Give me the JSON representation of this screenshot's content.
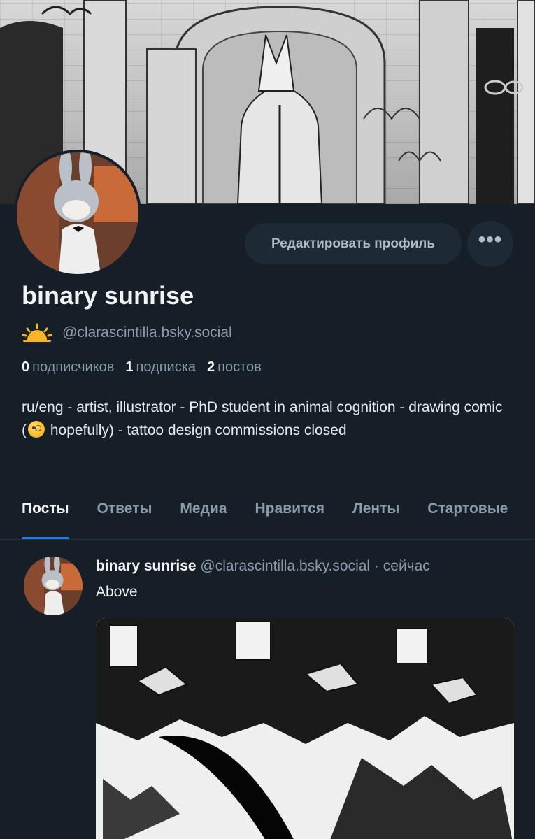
{
  "profile": {
    "display_name": "binary sunrise",
    "handle": "@clarascintilla.bsky.social",
    "edit_button_label": "Редактировать профиль",
    "more_button_label": "•••",
    "stats": {
      "followers_count": "0",
      "followers_label": "подписчиков",
      "following_count": "1",
      "following_label": "подписка",
      "posts_count": "2",
      "posts_label": "постов"
    },
    "bio": {
      "part1": "ru/eng - artist, illustrator - PhD student in animal cognition - drawing comic (",
      "part2": " hopefully) - tattoo design commissions closed"
    }
  },
  "tabs": [
    {
      "label": "Посты",
      "active": true
    },
    {
      "label": "Ответы",
      "active": false
    },
    {
      "label": "Медиа",
      "active": false
    },
    {
      "label": "Нравится",
      "active": false
    },
    {
      "label": "Ленты",
      "active": false
    },
    {
      "label": "Стартовые",
      "active": false
    }
  ],
  "post": {
    "author_name": "binary sunrise",
    "author_handle": "@clarascintilla.bsky.social",
    "separator": "·",
    "time": "сейчас",
    "text": "Above"
  },
  "colors": {
    "background": "#161e27",
    "accent": "#1083fe",
    "muted_text": "#8c9aab",
    "button_bg": "#1e2936"
  },
  "icons": {
    "sun": "sunrise-emoji-icon",
    "more": "ellipsis-icon",
    "bio_emoji": "face-with-monocle-emoji-icon"
  }
}
